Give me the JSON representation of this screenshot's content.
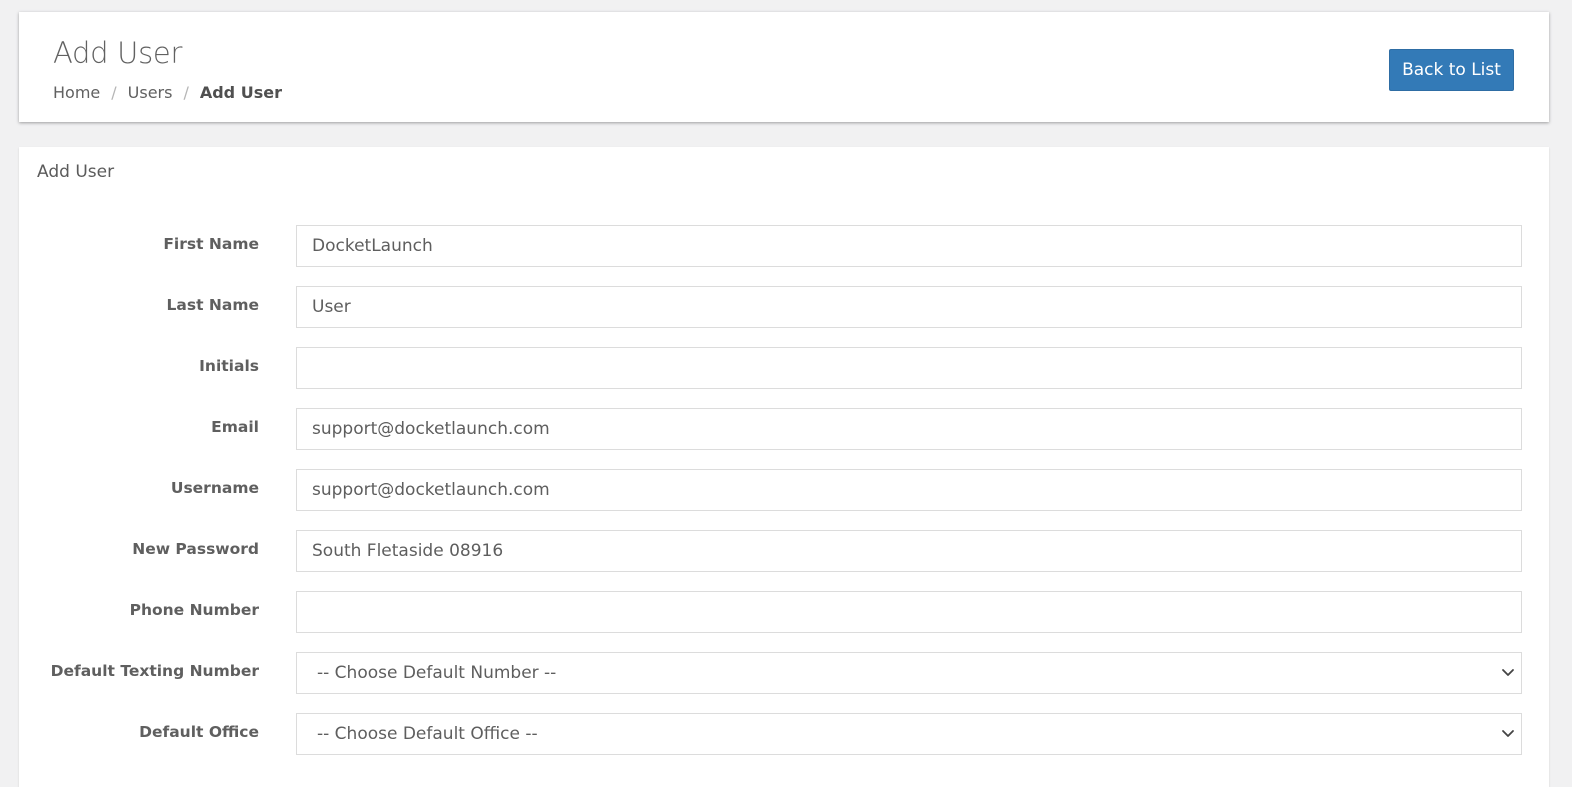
{
  "header": {
    "title": "Add User",
    "breadcrumb": {
      "home": "Home",
      "users": "Users",
      "current": "Add User",
      "separator": "/"
    },
    "back_button": "Back to List"
  },
  "form": {
    "title": "Add User",
    "fields": [
      {
        "label": "First Name",
        "value": "DocketLaunch",
        "type": "text"
      },
      {
        "label": "Last Name",
        "value": "User",
        "type": "text"
      },
      {
        "label": "Initials",
        "value": "",
        "type": "text"
      },
      {
        "label": "Email",
        "value": "support@docketlaunch.com",
        "type": "text"
      },
      {
        "label": "Username",
        "value": "support@docketlaunch.com",
        "type": "text"
      },
      {
        "label": "New Password",
        "value": "South Fletaside 08916",
        "type": "text"
      },
      {
        "label": "Phone Number",
        "value": "",
        "type": "text"
      },
      {
        "label": "Default Texting Number",
        "value": "-- Choose Default Number --",
        "type": "select"
      },
      {
        "label": "Default Office",
        "value": "-- Choose Default Office --",
        "type": "select"
      }
    ]
  },
  "icons": {
    "select_arrow": "chevron-down-icon"
  },
  "colors": {
    "primary_button": "#337ab7",
    "background": "#f1f1f2",
    "card": "#ffffff",
    "input_border": "#dcdcdc"
  }
}
